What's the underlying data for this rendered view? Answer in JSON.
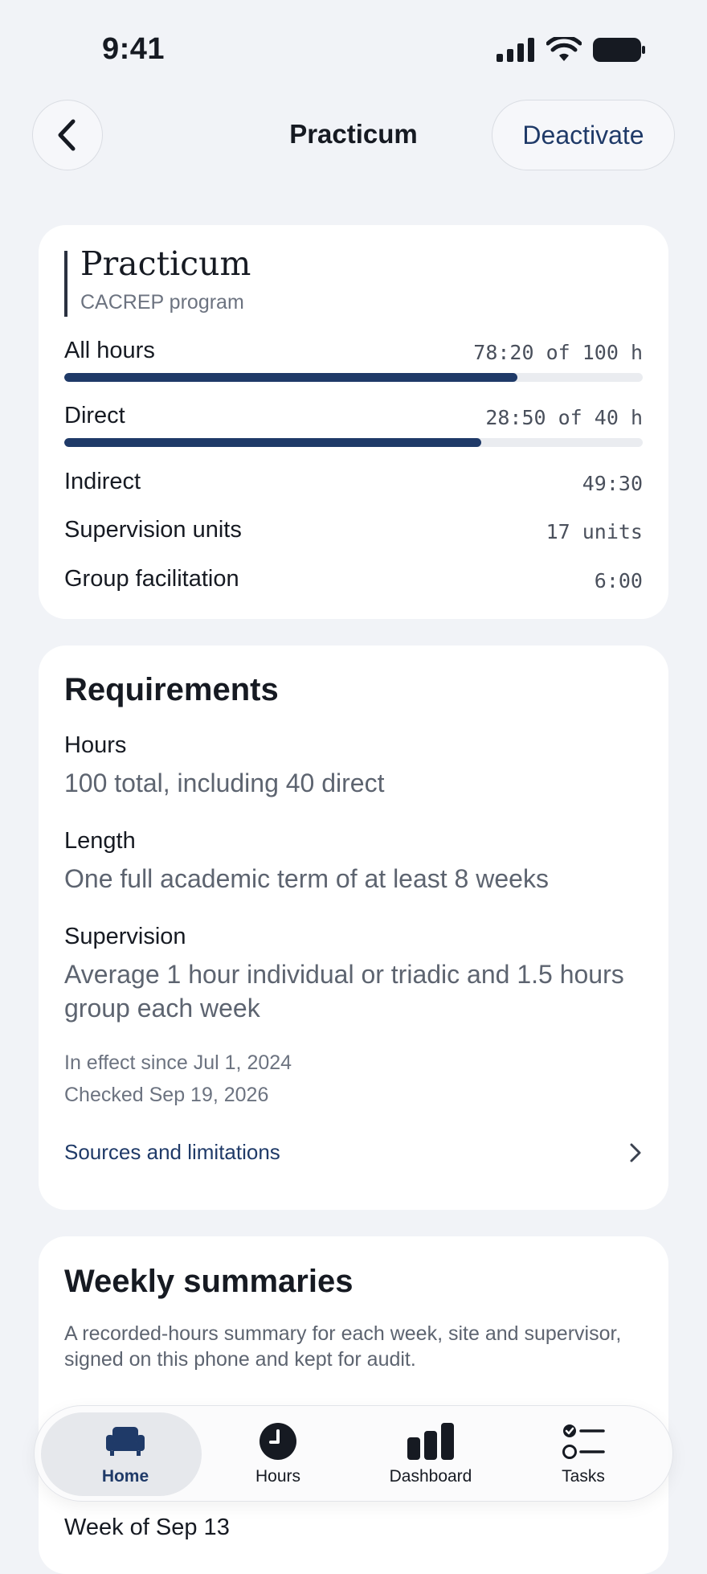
{
  "status_bar": {
    "time": "9:41"
  },
  "header": {
    "title": "Practicum",
    "deactivate_label": "Deactivate"
  },
  "program": {
    "name": "Practicum",
    "type": "CACREP program"
  },
  "hours": {
    "all": {
      "label": "All hours",
      "value": "78:20 of 100 h",
      "progress": 0.783
    },
    "direct": {
      "label": "Direct",
      "value": "28:50 of 40 h",
      "progress": 0.721
    },
    "rows": [
      {
        "label": "Indirect",
        "value": "49:30"
      },
      {
        "label": "Supervision units",
        "value": "17 units"
      },
      {
        "label": "Group facilitation",
        "value": "6:00"
      }
    ]
  },
  "requirements": {
    "title": "Requirements",
    "items": [
      {
        "label": "Hours",
        "value": "100 total, including 40 direct"
      },
      {
        "label": "Length",
        "value": "One full academic term of at least 8 weeks"
      },
      {
        "label": "Supervision",
        "value": "Average 1 hour individual or triadic and 1.5 hours group each week"
      }
    ],
    "effective": "In effect since Jul 1, 2024",
    "checked": "Checked Sep 19, 2026",
    "sources_link": "Sources and limitations"
  },
  "weekly": {
    "title": "Weekly summaries",
    "description": "A recorded-hours summary for each week, site and supervisor, signed on this phone and kept for audit.",
    "week_label": "Week of Sep 13"
  },
  "tabs": [
    {
      "label": "Home",
      "icon": "armchair-icon",
      "active": true
    },
    {
      "label": "Hours",
      "icon": "clock-icon",
      "active": false
    },
    {
      "label": "Dashboard",
      "icon": "bar-chart-icon",
      "active": false
    },
    {
      "label": "Tasks",
      "icon": "checklist-icon",
      "active": false
    }
  ],
  "colors": {
    "accent": "#1f3a68",
    "background": "#f1f3f7",
    "card": "#ffffff"
  }
}
